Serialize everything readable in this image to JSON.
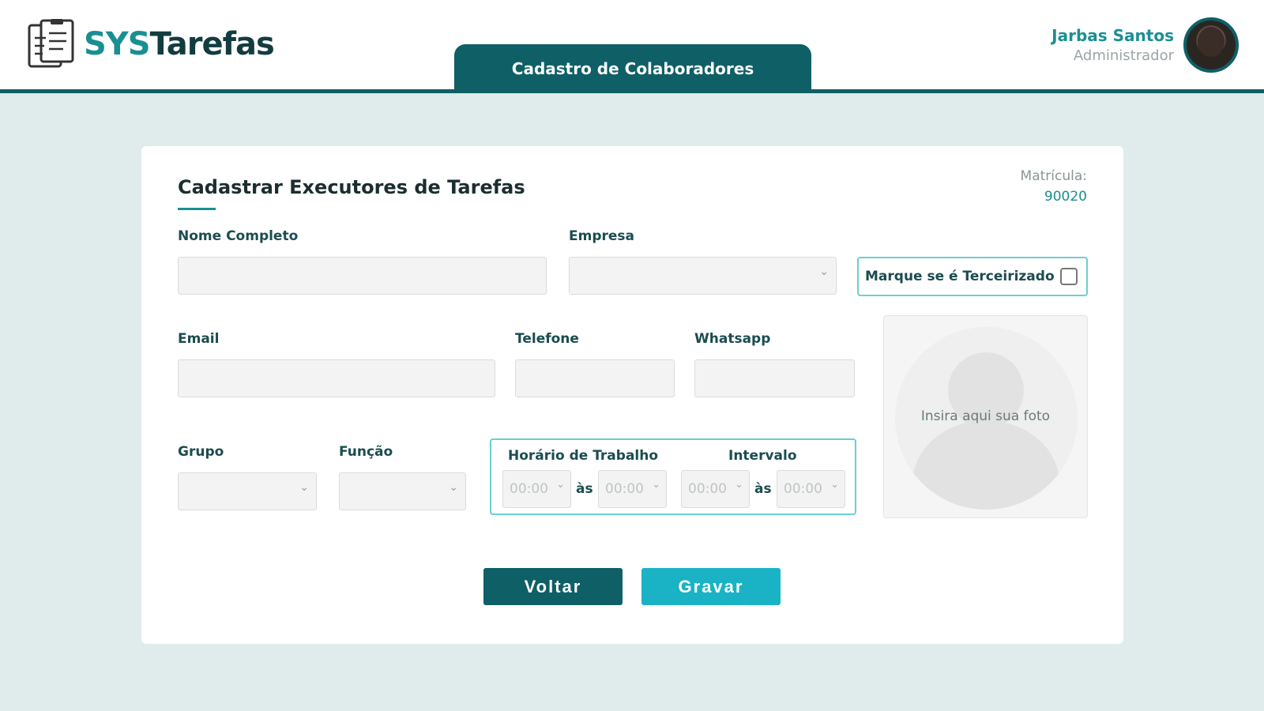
{
  "header": {
    "logo_sys": "SYS",
    "logo_rest": "Tarefas",
    "page_tab": "Cadastro de Colaboradores"
  },
  "user": {
    "name": "Jarbas Santos",
    "role": "Administrador"
  },
  "form": {
    "title": "Cadastrar Executores de Tarefas",
    "matricula_label": "Matrícula:",
    "matricula_value": "90020",
    "fields": {
      "nome_completo": "Nome Completo",
      "empresa": "Empresa",
      "terceirizado": "Marque se é Terceirizado",
      "email": "Email",
      "telefone": "Telefone",
      "whatsapp": "Whatsapp",
      "grupo": "Grupo",
      "funcao": "Função",
      "horario_trabalho": "Horário de Trabalho",
      "intervalo": "Intervalo"
    },
    "time_values": {
      "work_start": "00:00",
      "work_end": "00:00",
      "break_start": "00:00",
      "break_end": "00:00"
    },
    "as_label": "às",
    "photo_placeholder": "Insira aqui sua foto"
  },
  "buttons": {
    "voltar": "Voltar",
    "gravar": "Gravar"
  },
  "colors": {
    "primary": "#0e5f66",
    "accent": "#1a8f93",
    "button_save": "#1ab3c6",
    "background": "#dfeceb"
  }
}
